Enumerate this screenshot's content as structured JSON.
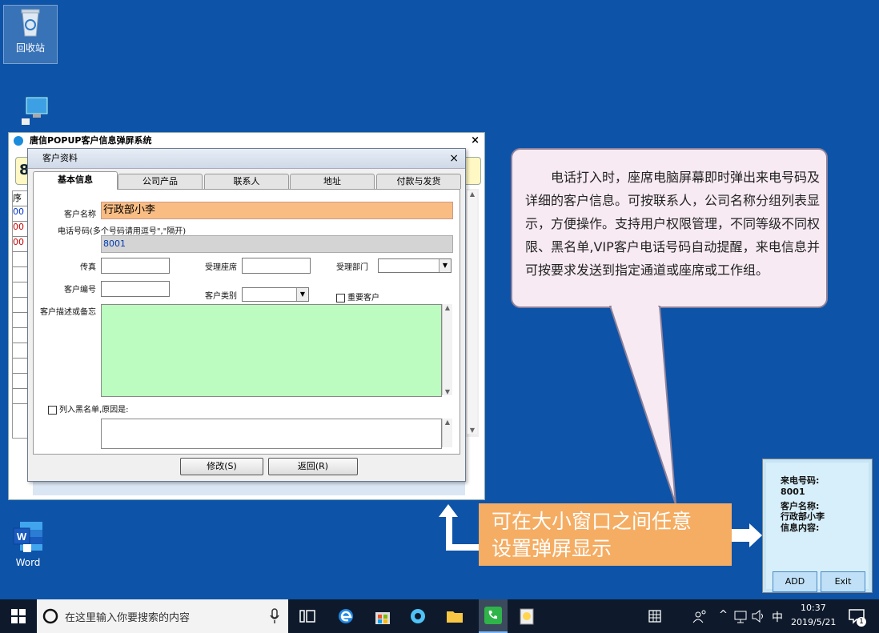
{
  "desktop": {
    "icons": [
      {
        "label": "回收站"
      },
      {
        "label": ""
      },
      {
        "label": "Word"
      }
    ]
  },
  "main_window": {
    "title": "唐信POPUP客户信息弹屏系统",
    "close_glyph": "×",
    "yellow_text": "80",
    "list_header": "序",
    "list_rows": [
      "00",
      "00",
      "00"
    ]
  },
  "dialog": {
    "title": "客户资料",
    "close_glyph": "×",
    "tabs": [
      "基本信息",
      "公司产品",
      "联系人",
      "地址",
      "付款与发货"
    ],
    "fields": {
      "customer_name_label": "客户名称",
      "customer_name_value": "行政部小李",
      "phone_label": "电话号码(多个号码请用逗号\",\"隔开)",
      "phone_value": "8001",
      "fax_label": "传真",
      "handler_seat_label": "受理座席",
      "handler_dept_label": "受理部门",
      "customer_no_label": "客户编号",
      "customer_type_label": "客户类别",
      "vip_label": "重要客户",
      "desc_label": "客户描述或备忘",
      "blacklist_label": "列入黑名单,原因是:"
    },
    "buttons": {
      "edit": "修改(S)",
      "back": "返回(R)"
    }
  },
  "callout": {
    "text": "电话打入时，座席电脑屏幕即时弹出来电号码及详细的客户信息。可按联系人，公司名称分组列表显示，方便操作。支持用户权限管理，不同等级不同权限、黑名单,VIP客户电话号码自动提醒，来电信息并可按要求发送到指定通道或座席或工作组。"
  },
  "banner": {
    "line1": "可在大小窗口之间任意",
    "line2": "设置弹屏显示"
  },
  "mini_popup": {
    "caller_label": "来电号码:",
    "caller_value": "8001",
    "name_label": "客户名称:",
    "name_value": "行政部小李",
    "info_label": "信息内容:",
    "add_button": "ADD",
    "exit_button": "Exit"
  },
  "taskbar": {
    "search_placeholder": "在这里输入你要搜索的内容",
    "ime": "中",
    "time": "10:37",
    "date": "2019/5/21",
    "notification_count": "1"
  },
  "colors": {
    "desktop": "#0d53a8",
    "name_field": "#f9bd84",
    "desc_area": "#bdfcc1",
    "banner": "#f5ad63",
    "callout_bg": "#f7eaf2"
  }
}
